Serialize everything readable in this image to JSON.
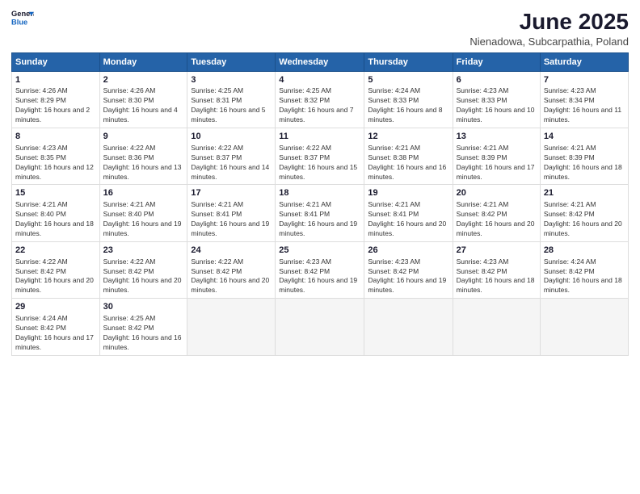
{
  "logo": {
    "line1": "General",
    "line2": "Blue"
  },
  "title": "June 2025",
  "subtitle": "Nienadowa, Subcarpathia, Poland",
  "weekdays": [
    "Sunday",
    "Monday",
    "Tuesday",
    "Wednesday",
    "Thursday",
    "Friday",
    "Saturday"
  ],
  "weeks": [
    [
      {
        "day": "1",
        "sunrise": "4:26 AM",
        "sunset": "8:29 PM",
        "daylight": "16 hours and 2 minutes."
      },
      {
        "day": "2",
        "sunrise": "4:26 AM",
        "sunset": "8:30 PM",
        "daylight": "16 hours and 4 minutes."
      },
      {
        "day": "3",
        "sunrise": "4:25 AM",
        "sunset": "8:31 PM",
        "daylight": "16 hours and 5 minutes."
      },
      {
        "day": "4",
        "sunrise": "4:25 AM",
        "sunset": "8:32 PM",
        "daylight": "16 hours and 7 minutes."
      },
      {
        "day": "5",
        "sunrise": "4:24 AM",
        "sunset": "8:33 PM",
        "daylight": "16 hours and 8 minutes."
      },
      {
        "day": "6",
        "sunrise": "4:23 AM",
        "sunset": "8:33 PM",
        "daylight": "16 hours and 10 minutes."
      },
      {
        "day": "7",
        "sunrise": "4:23 AM",
        "sunset": "8:34 PM",
        "daylight": "16 hours and 11 minutes."
      }
    ],
    [
      {
        "day": "8",
        "sunrise": "4:23 AM",
        "sunset": "8:35 PM",
        "daylight": "16 hours and 12 minutes."
      },
      {
        "day": "9",
        "sunrise": "4:22 AM",
        "sunset": "8:36 PM",
        "daylight": "16 hours and 13 minutes."
      },
      {
        "day": "10",
        "sunrise": "4:22 AM",
        "sunset": "8:37 PM",
        "daylight": "16 hours and 14 minutes."
      },
      {
        "day": "11",
        "sunrise": "4:22 AM",
        "sunset": "8:37 PM",
        "daylight": "16 hours and 15 minutes."
      },
      {
        "day": "12",
        "sunrise": "4:21 AM",
        "sunset": "8:38 PM",
        "daylight": "16 hours and 16 minutes."
      },
      {
        "day": "13",
        "sunrise": "4:21 AM",
        "sunset": "8:39 PM",
        "daylight": "16 hours and 17 minutes."
      },
      {
        "day": "14",
        "sunrise": "4:21 AM",
        "sunset": "8:39 PM",
        "daylight": "16 hours and 18 minutes."
      }
    ],
    [
      {
        "day": "15",
        "sunrise": "4:21 AM",
        "sunset": "8:40 PM",
        "daylight": "16 hours and 18 minutes."
      },
      {
        "day": "16",
        "sunrise": "4:21 AM",
        "sunset": "8:40 PM",
        "daylight": "16 hours and 19 minutes."
      },
      {
        "day": "17",
        "sunrise": "4:21 AM",
        "sunset": "8:41 PM",
        "daylight": "16 hours and 19 minutes."
      },
      {
        "day": "18",
        "sunrise": "4:21 AM",
        "sunset": "8:41 PM",
        "daylight": "16 hours and 19 minutes."
      },
      {
        "day": "19",
        "sunrise": "4:21 AM",
        "sunset": "8:41 PM",
        "daylight": "16 hours and 20 minutes."
      },
      {
        "day": "20",
        "sunrise": "4:21 AM",
        "sunset": "8:42 PM",
        "daylight": "16 hours and 20 minutes."
      },
      {
        "day": "21",
        "sunrise": "4:21 AM",
        "sunset": "8:42 PM",
        "daylight": "16 hours and 20 minutes."
      }
    ],
    [
      {
        "day": "22",
        "sunrise": "4:22 AM",
        "sunset": "8:42 PM",
        "daylight": "16 hours and 20 minutes."
      },
      {
        "day": "23",
        "sunrise": "4:22 AM",
        "sunset": "8:42 PM",
        "daylight": "16 hours and 20 minutes."
      },
      {
        "day": "24",
        "sunrise": "4:22 AM",
        "sunset": "8:42 PM",
        "daylight": "16 hours and 20 minutes."
      },
      {
        "day": "25",
        "sunrise": "4:23 AM",
        "sunset": "8:42 PM",
        "daylight": "16 hours and 19 minutes."
      },
      {
        "day": "26",
        "sunrise": "4:23 AM",
        "sunset": "8:42 PM",
        "daylight": "16 hours and 19 minutes."
      },
      {
        "day": "27",
        "sunrise": "4:23 AM",
        "sunset": "8:42 PM",
        "daylight": "16 hours and 18 minutes."
      },
      {
        "day": "28",
        "sunrise": "4:24 AM",
        "sunset": "8:42 PM",
        "daylight": "16 hours and 18 minutes."
      }
    ],
    [
      {
        "day": "29",
        "sunrise": "4:24 AM",
        "sunset": "8:42 PM",
        "daylight": "16 hours and 17 minutes."
      },
      {
        "day": "30",
        "sunrise": "4:25 AM",
        "sunset": "8:42 PM",
        "daylight": "16 hours and 16 minutes."
      },
      null,
      null,
      null,
      null,
      null
    ]
  ]
}
